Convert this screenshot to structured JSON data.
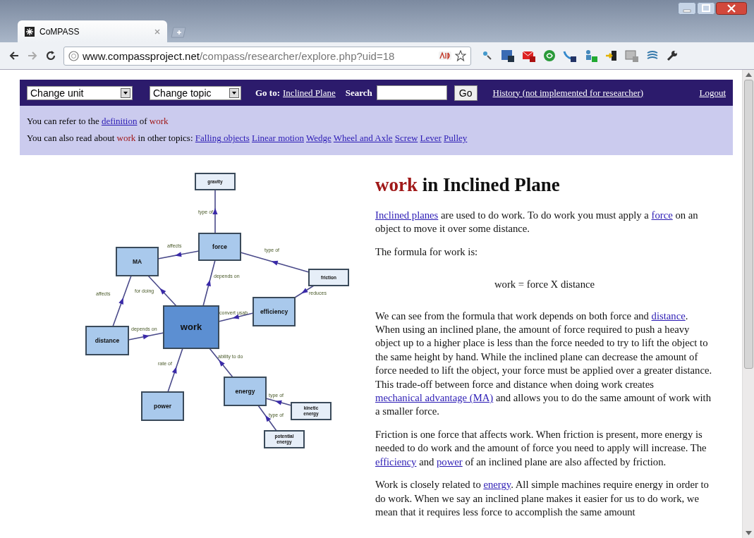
{
  "browser": {
    "tab": {
      "title": "CoMPASS"
    },
    "address": {
      "host": "www.compassproject.net",
      "path": "/compass/researcher/explore.php?uid=18"
    }
  },
  "navbar": {
    "unit_select": "Change unit",
    "topic_select": "Change topic",
    "goto_label": "Go to:",
    "goto_link": "Inclined Plane",
    "search_label": "Search",
    "go_button": "Go",
    "history_link": "History (not implemented for researcher)",
    "logout_link": "Logout"
  },
  "info": [
    {
      "segments": [
        {
          "kind": "text",
          "text": "You can refer to the"
        },
        {
          "kind": "link",
          "text": "definition"
        },
        {
          "kind": "text",
          "text": "of"
        },
        {
          "kind": "term",
          "text": "work"
        }
      ]
    },
    {
      "segments": [
        {
          "kind": "text",
          "text": "You can also read about"
        },
        {
          "kind": "term",
          "text": "work"
        },
        {
          "kind": "text",
          "text": "in other topics:"
        },
        {
          "kind": "link",
          "text": "Falling objects"
        },
        {
          "kind": "link",
          "text": "Linear motion"
        },
        {
          "kind": "link",
          "text": "Wedge"
        },
        {
          "kind": "link",
          "text": "Wheel and Axle"
        },
        {
          "kind": "link",
          "text": "Screw"
        },
        {
          "kind": "link",
          "text": "Lever"
        },
        {
          "kind": "link",
          "text": "Pulley"
        }
      ]
    }
  ],
  "concept_map": {
    "nodes": [
      {
        "label": "gravity",
        "kind": "leaf"
      },
      {
        "label": "force",
        "kind": "concept"
      },
      {
        "label": "MA",
        "kind": "concept"
      },
      {
        "label": "friction",
        "kind": "leaf"
      },
      {
        "label": "efficiency",
        "kind": "concept"
      },
      {
        "label": "work",
        "kind": "central"
      },
      {
        "label": "distance",
        "kind": "concept"
      },
      {
        "label": "power",
        "kind": "concept"
      },
      {
        "label": "energy",
        "kind": "concept"
      },
      {
        "label": "kinetic energy",
        "kind": "leaf"
      },
      {
        "label": "potential energy",
        "kind": "leaf"
      }
    ],
    "edges": [
      {
        "label": "type of"
      },
      {
        "label": "affects"
      },
      {
        "label": "type of"
      },
      {
        "label": "reduces"
      },
      {
        "label": "depends on"
      },
      {
        "label": "for doing"
      },
      {
        "label": "affects"
      },
      {
        "label": "depends on"
      },
      {
        "label": "convert usab"
      },
      {
        "label": "rate of"
      },
      {
        "label": "ability to do"
      },
      {
        "label": "type of"
      },
      {
        "label": "type of"
      }
    ]
  },
  "article": {
    "title": {
      "term": "work",
      "rest": "in Inclined Plane"
    },
    "paragraphs": [
      {
        "kind": "text",
        "segments": [
          {
            "kind": "link",
            "text": "Inclined planes"
          },
          {
            "kind": "text",
            "text": " are used to do work. To do work you must apply a "
          },
          {
            "kind": "link",
            "text": "force"
          },
          {
            "kind": "text",
            "text": " on an object to move it over some distance."
          }
        ]
      },
      {
        "kind": "text",
        "segments": [
          {
            "kind": "text",
            "text": "The formula for work is:"
          }
        ]
      },
      {
        "kind": "formula",
        "segments": [
          {
            "kind": "text",
            "text": "work = force X distance"
          }
        ]
      },
      {
        "kind": "text",
        "segments": [
          {
            "kind": "text",
            "text": "We can see from the formula that work depends on both force and "
          },
          {
            "kind": "link",
            "text": "distance"
          },
          {
            "kind": "text",
            "text": ". When using an inclined plane, the amount of force required to push a heavy object up to a higher place is less than the force needed to try to lift the object to the same height by hand. While the inclined plane can decrease the amount of force needed to lift the object, your force must be applied over a greater distance. This trade-off between force and distance when doing work creates "
          },
          {
            "kind": "link",
            "text": "mechanical advantage (MA)"
          },
          {
            "kind": "text",
            "text": " and allows you to do the same amount of work with a smaller force."
          }
        ]
      },
      {
        "kind": "text",
        "segments": [
          {
            "kind": "text",
            "text": "Friction is one force that affects work. When friction is present, more energy is needed to do work and the amount of force you need to apply will increase. The "
          },
          {
            "kind": "link",
            "text": "efficiency"
          },
          {
            "kind": "text",
            "text": " and "
          },
          {
            "kind": "link",
            "text": "power"
          },
          {
            "kind": "text",
            "text": " of an inclined plane are also affected by friction."
          }
        ]
      },
      {
        "kind": "text",
        "segments": [
          {
            "kind": "text",
            "text": "Work is closely related to "
          },
          {
            "kind": "link",
            "text": "energy"
          },
          {
            "kind": "text",
            "text": ". All simple machines require energy in order to do work. When we say an inclined plane makes it easier for us to do work, we mean that it requires less force to accomplish the same amount"
          }
        ]
      }
    ]
  }
}
